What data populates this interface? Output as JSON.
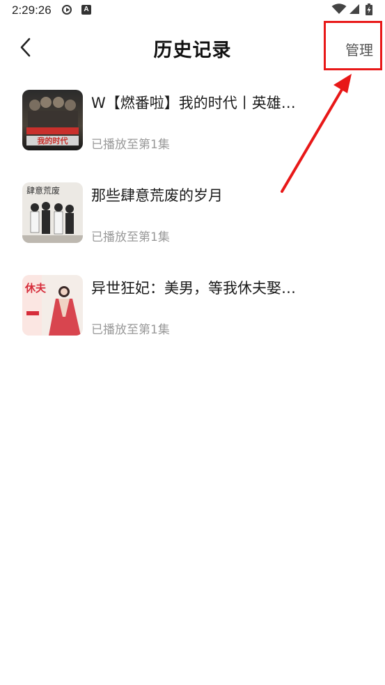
{
  "status_bar": {
    "time": "2:29:26",
    "notification_icon_letter": "A"
  },
  "header": {
    "title": "历史记录",
    "manage_label": "管理"
  },
  "annotation": {
    "highlight_color": "#e81818"
  },
  "history": [
    {
      "title": "W【燃番啦】我的时代丨英雄…",
      "progress": "已播放至第1集",
      "cover_text": "我的时代",
      "cover_icon": "dark-group-portrait-cover"
    },
    {
      "title": "那些肆意荒废的岁月",
      "progress": "已播放至第1集",
      "cover_text": "肆意荒废",
      "cover_icon": "group-of-students-cover"
    },
    {
      "title": "异世狂妃：美男，等我休夫娶…",
      "progress": "已播放至第1集",
      "cover_text": "休夫",
      "cover_icon": "ancient-lady-cover"
    }
  ]
}
